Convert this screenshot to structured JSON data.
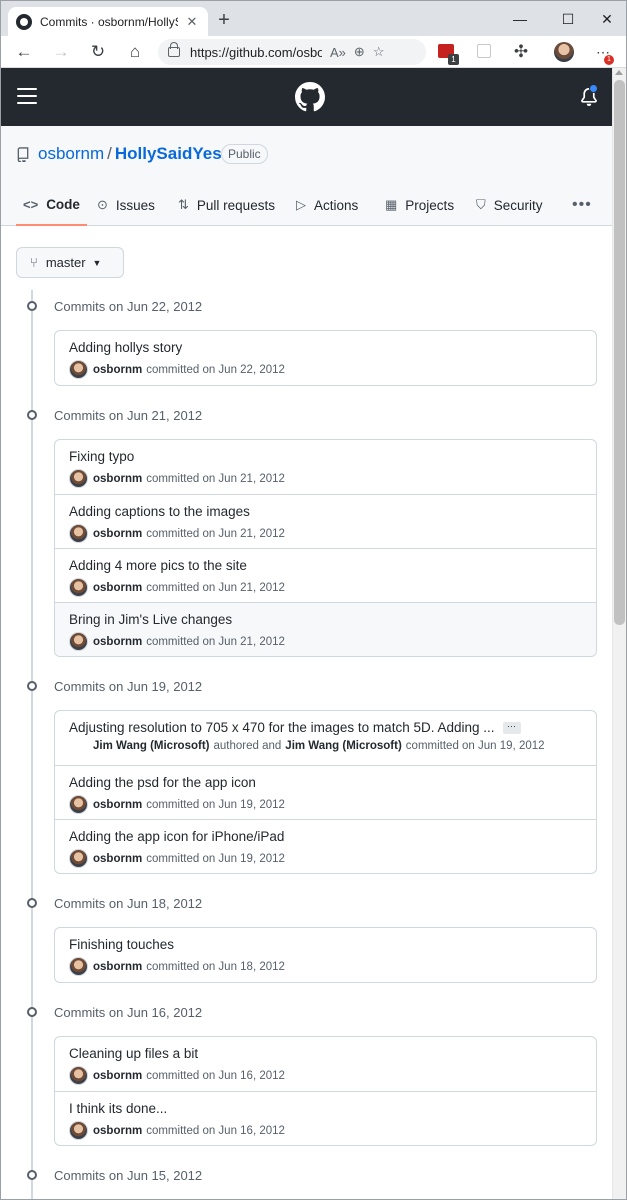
{
  "browser": {
    "tab_title": "Commits · osbornm/HollySaidYes",
    "tab_close": "✕",
    "new_tab": "+",
    "url": "https://github.com/osbornm/HollySaidYes/commits/master",
    "window_min": "—",
    "window_max": "☐",
    "window_close": "✕",
    "ext_badge": "1",
    "menu_badge": "1"
  },
  "repo": {
    "owner": "osbornm",
    "separator": "/",
    "name": "HollySaidYes",
    "visibility": "Public"
  },
  "tabs": [
    {
      "label": "Code",
      "icon": "code-icon"
    },
    {
      "label": "Issues",
      "icon": "issue-icon"
    },
    {
      "label": "Pull requests",
      "icon": "pull-request-icon"
    },
    {
      "label": "Actions",
      "icon": "play-icon"
    },
    {
      "label": "Projects",
      "icon": "table-icon"
    },
    {
      "label": "Security",
      "icon": "shield-icon"
    }
  ],
  "more_label": "•••",
  "branch": "master",
  "groups": [
    {
      "date_label": "Commits on Jun 22, 2012",
      "commits": [
        {
          "title": "Adding hollys story",
          "author": "osbornm",
          "text": "committed on Jun 22, 2012"
        }
      ]
    },
    {
      "date_label": "Commits on Jun 21, 2012",
      "commits": [
        {
          "title": "Fixing typo",
          "author": "osbornm",
          "text": "committed on Jun 21, 2012"
        },
        {
          "title": "Adding captions to the images",
          "author": "osbornm",
          "text": "committed on Jun 21, 2012"
        },
        {
          "title": "Adding 4 more pics to the site",
          "author": "osbornm",
          "text": "committed on Jun 21, 2012"
        },
        {
          "title": "Bring in Jim's Live changes",
          "author": "osbornm",
          "text": "committed on Jun 21, 2012"
        }
      ]
    },
    {
      "date_label": "Commits on Jun 19, 2012",
      "commits": [
        {
          "title": "Adjusting resolution to 705 x 470 for the images to match 5D. Adding ...",
          "author": "Jim Wang (Microsoft)",
          "mid": "authored and",
          "author2": "Jim Wang (Microsoft)",
          "text": "committed on Jun 19, 2012",
          "ellipsis": "···"
        },
        {
          "title": "Adding the psd for the app icon",
          "author": "osbornm",
          "text": "committed on Jun 19, 2012"
        },
        {
          "title": "Adding the app icon for iPhone/iPad",
          "author": "osbornm",
          "text": "committed on Jun 19, 2012"
        }
      ]
    },
    {
      "date_label": "Commits on Jun 18, 2012",
      "commits": [
        {
          "title": "Finishing touches",
          "author": "osbornm",
          "text": "committed on Jun 18, 2012"
        }
      ]
    },
    {
      "date_label": "Commits on Jun 16, 2012",
      "commits": [
        {
          "title": "Cleaning up files a bit",
          "author": "osbornm",
          "text": "committed on Jun 16, 2012"
        },
        {
          "title": "I think its done...",
          "author": "osbornm",
          "text": "committed on Jun 16, 2012"
        }
      ]
    },
    {
      "date_label": "Commits on Jun 15, 2012",
      "commits": []
    }
  ]
}
